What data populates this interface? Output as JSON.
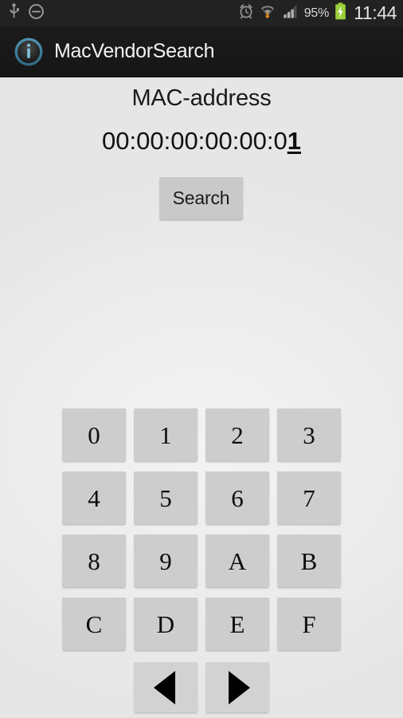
{
  "status_bar": {
    "left_icons": [
      "usb-icon",
      "do-not-disturb-icon"
    ],
    "right_icons": [
      "alarm-clock-icon",
      "wifi-download-icon",
      "signal-bars-icon",
      "battery-charging-icon"
    ],
    "battery_percent": "95%",
    "time": "11:44",
    "background_color": "#222222",
    "text_color": "#e2e2e2"
  },
  "title_bar": {
    "icon": "info-circle-icon",
    "title": "MacVendorSearch",
    "background_color": "#1b1b1b",
    "accent_color": "#4a90a8"
  },
  "main": {
    "field_label": "MAC-address",
    "mac_address": {
      "prefix": "00:00:00:00:00:0",
      "cursor_digit": "1",
      "full_value": "00:00:00:00:00:01"
    },
    "search_button": {
      "label": "Search",
      "color": "#c9c9c9"
    }
  },
  "keypad": {
    "rows": [
      [
        "0",
        "1",
        "2",
        "3"
      ],
      [
        "4",
        "5",
        "6",
        "7"
      ],
      [
        "8",
        "9",
        "A",
        "B"
      ],
      [
        "C",
        "D",
        "E",
        "F"
      ]
    ],
    "key_color": "#cdcdcd"
  },
  "navigation": {
    "prev_icon": "triangle-left-icon",
    "next_icon": "triangle-right-icon",
    "key_color": "#d2d2d2"
  }
}
